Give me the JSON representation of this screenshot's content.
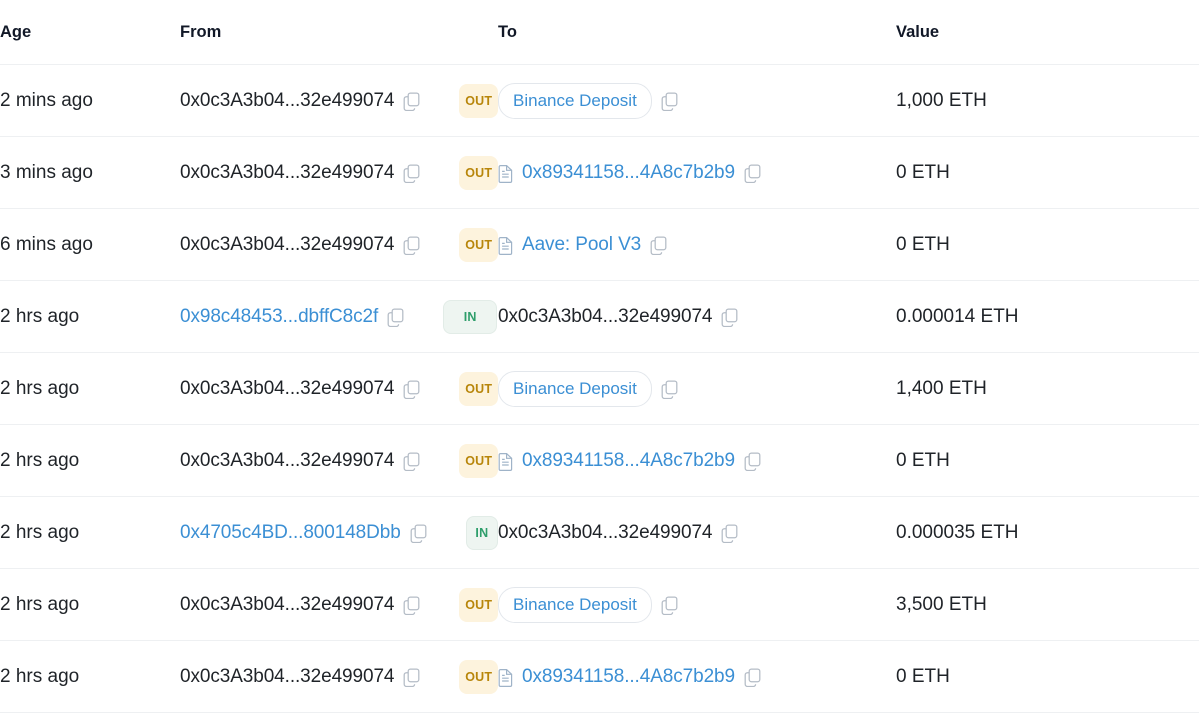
{
  "table": {
    "columns": [
      {
        "key": "age",
        "label": "Age",
        "sorted": true,
        "color": "#2d7dd2"
      },
      {
        "key": "from",
        "label": "From",
        "sorted": false,
        "color": "#111827"
      },
      {
        "key": "to",
        "label": "To",
        "sorted": false,
        "color": "#111827"
      },
      {
        "key": "value",
        "label": "Value",
        "sorted": false,
        "color": "#111827"
      }
    ],
    "icons": {
      "copy": "copy-icon",
      "contract": "contract-document-icon"
    },
    "badges": {
      "out": {
        "label": "OUT",
        "bg": "#fdf3dd",
        "fg": "#b8860b"
      },
      "in": {
        "label": "IN",
        "bg": "#eef5f1",
        "fg": "#2e9e6b"
      }
    },
    "rows": [
      {
        "age": "2 mins ago",
        "from": {
          "text": "0x0c3A3b04...32e499074",
          "style": "plain",
          "copy": true,
          "contract": false,
          "tag": false
        },
        "direction": "OUT",
        "to": {
          "text": "Binance Deposit",
          "style": "link",
          "copy": true,
          "contract": false,
          "tag": true
        },
        "value": "1,000 ETH"
      },
      {
        "age": "3 mins ago",
        "from": {
          "text": "0x0c3A3b04...32e499074",
          "style": "plain",
          "copy": true,
          "contract": false,
          "tag": false
        },
        "direction": "OUT",
        "to": {
          "text": "0x89341158...4A8c7b2b9",
          "style": "link",
          "copy": true,
          "contract": true,
          "tag": false
        },
        "value": "0 ETH"
      },
      {
        "age": "6 mins ago",
        "from": {
          "text": "0x0c3A3b04...32e499074",
          "style": "plain",
          "copy": true,
          "contract": false,
          "tag": false
        },
        "direction": "OUT",
        "to": {
          "text": "Aave: Pool V3",
          "style": "link",
          "copy": true,
          "contract": true,
          "tag": false
        },
        "value": "0 ETH"
      },
      {
        "age": "2 hrs ago",
        "from": {
          "text": "0x98c48453...dbffC8c2f",
          "style": "link",
          "copy": true,
          "contract": false,
          "tag": false
        },
        "direction": "IN",
        "to": {
          "text": "0x0c3A3b04...32e499074",
          "style": "plain",
          "copy": true,
          "contract": false,
          "tag": false
        },
        "value": "0.000014 ETH"
      },
      {
        "age": "2 hrs ago",
        "from": {
          "text": "0x0c3A3b04...32e499074",
          "style": "plain",
          "copy": true,
          "contract": false,
          "tag": false
        },
        "direction": "OUT",
        "to": {
          "text": "Binance Deposit",
          "style": "link",
          "copy": true,
          "contract": false,
          "tag": true
        },
        "value": "1,400 ETH"
      },
      {
        "age": "2 hrs ago",
        "from": {
          "text": "0x0c3A3b04...32e499074",
          "style": "plain",
          "copy": true,
          "contract": false,
          "tag": false
        },
        "direction": "OUT",
        "to": {
          "text": "0x89341158...4A8c7b2b9",
          "style": "link",
          "copy": true,
          "contract": true,
          "tag": false
        },
        "value": "0 ETH"
      },
      {
        "age": "2 hrs ago",
        "from": {
          "text": "0x4705c4BD...800148Dbb",
          "style": "link",
          "copy": true,
          "contract": false,
          "tag": false
        },
        "direction": "IN",
        "to": {
          "text": "0x0c3A3b04...32e499074",
          "style": "plain",
          "copy": true,
          "contract": false,
          "tag": false
        },
        "value": "0.000035 ETH"
      },
      {
        "age": "2 hrs ago",
        "from": {
          "text": "0x0c3A3b04...32e499074",
          "style": "plain",
          "copy": true,
          "contract": false,
          "tag": false
        },
        "direction": "OUT",
        "to": {
          "text": "Binance Deposit",
          "style": "link",
          "copy": true,
          "contract": false,
          "tag": true
        },
        "value": "3,500 ETH"
      },
      {
        "age": "2 hrs ago",
        "from": {
          "text": "0x0c3A3b04...32e499074",
          "style": "plain",
          "copy": true,
          "contract": false,
          "tag": false
        },
        "direction": "OUT",
        "to": {
          "text": "0x89341158...4A8c7b2b9",
          "style": "link",
          "copy": true,
          "contract": true,
          "tag": false
        },
        "value": "0 ETH"
      }
    ]
  }
}
